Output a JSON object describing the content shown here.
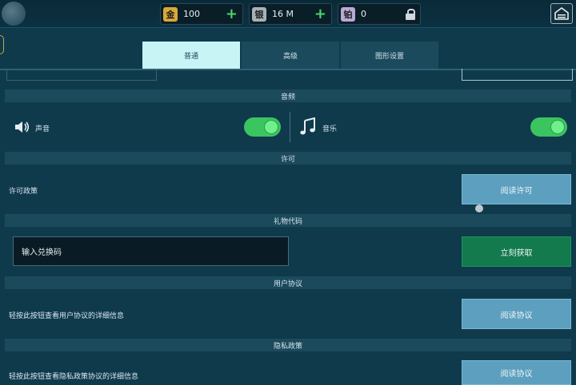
{
  "currencies": [
    {
      "badge": "金",
      "value": "100",
      "color": "#d9a93a",
      "action": "+"
    },
    {
      "badge": "银",
      "value": "16 M",
      "color": "#a8b0b8",
      "action": "+"
    },
    {
      "badge": "铂",
      "value": "0",
      "color": "#b8a9d6",
      "action": "lock"
    }
  ],
  "tabs": [
    {
      "label": "普通",
      "active": true
    },
    {
      "label": "高级",
      "active": false
    },
    {
      "label": "图形设置",
      "active": false
    }
  ],
  "audio": {
    "header": "音频",
    "sound_label": "声音",
    "sound_on": true,
    "music_label": "音乐",
    "music_on": true
  },
  "license": {
    "header": "许可",
    "label": "许可政策",
    "button": "阅读许可"
  },
  "gift": {
    "header": "礼物代码",
    "placeholder": "输入兑换码",
    "button": "立刻获取"
  },
  "user_agreement": {
    "header": "用户协议",
    "label": "轻按此按钮查看用户协议的详细信息",
    "button": "阅读协议"
  },
  "privacy": {
    "header": "隐私政策",
    "label": "轻按此按钮查看隐私政策协议的详细信息",
    "button": "阅读协议"
  },
  "colors": {
    "toggle_on": "#3bc561",
    "button_blue": "#5c9fbf",
    "button_green": "#127a4c",
    "tab_active": "#c8f4f6"
  }
}
